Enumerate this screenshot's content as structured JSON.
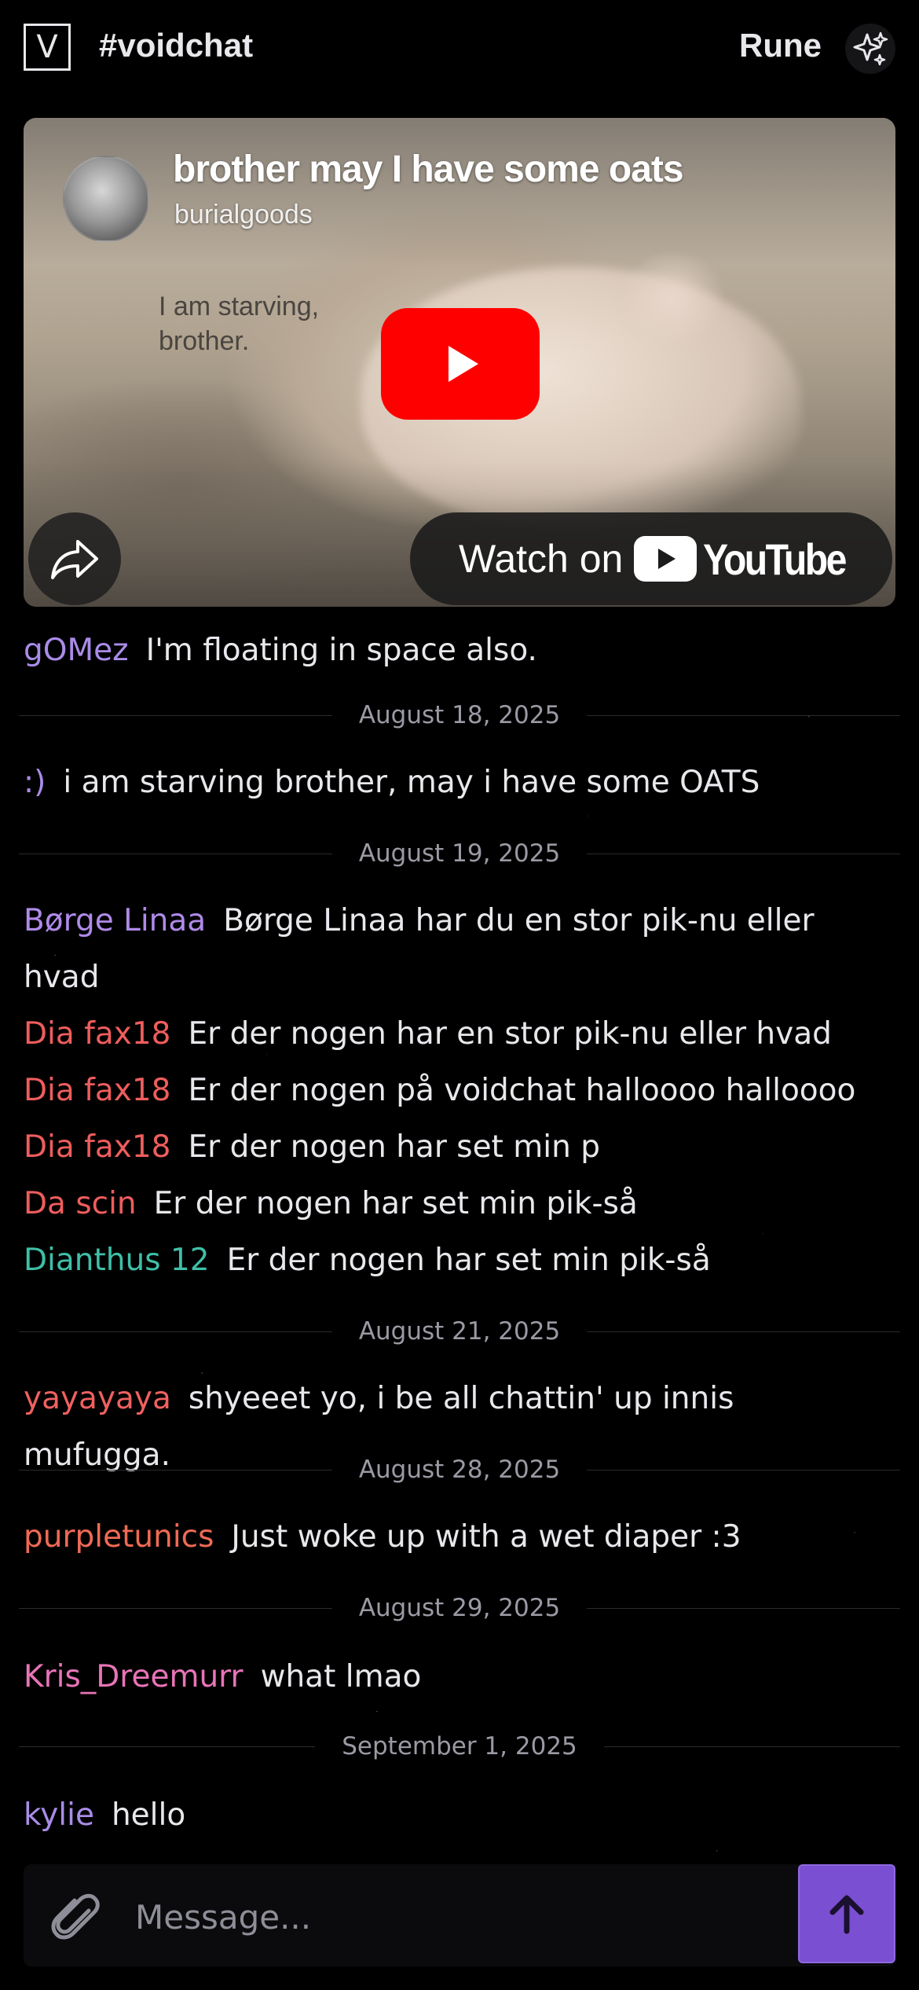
{
  "header": {
    "logo_letter": "V",
    "channel": "#voidchat",
    "username": "Rune",
    "sparkle_icon": "sparkles-icon"
  },
  "embed": {
    "title": "brother may I have some oats",
    "channel": "burialgoods",
    "caption": "I am starving, brother.",
    "watch_on": "Watch on",
    "youtube_word": "YouTube",
    "play_color": "#ff0000",
    "icons": {
      "play": "play-icon",
      "share": "share-icon",
      "youtube": "youtube-logo-icon"
    }
  },
  "messages": [
    {
      "author": "gOMez",
      "color": "#a98ce8",
      "text": "I'm floating in space also."
    },
    {
      "divider": "August 18, 2025"
    },
    {
      "author": ":)",
      "color": "#a98ce8",
      "text": "i am starving brother, may i have some OATS"
    },
    {
      "divider": "August 19, 2025"
    },
    {
      "author": "Børge Linaa",
      "color": "#b08ae8",
      "text": "Børge Linaa har du en stor pik-nu eller hvad"
    },
    {
      "author": "Dia fax18",
      "color": "#ef5d5d",
      "text": "Er der nogen har en stor pik-nu eller hvad"
    },
    {
      "author": "Dia fax18",
      "color": "#ef5d5d",
      "text": "Er der nogen på voidchat halloooo halloooo"
    },
    {
      "author": "Dia fax18",
      "color": "#ef5d5d",
      "text": "Er der nogen har set min p"
    },
    {
      "author": "Da scin",
      "color": "#ef5d5d",
      "text": "Er der nogen har set min pik-så"
    },
    {
      "author": "Dianthus 12",
      "color": "#3fbfa8",
      "text": "Er der nogen har set min pik-så"
    },
    {
      "divider": "August 21, 2025"
    },
    {
      "author": "yayayaya",
      "color": "#f06060",
      "text": "shyeeet yo, i be all chattin' up innis mufugga."
    },
    {
      "divider": "August 28, 2025"
    },
    {
      "author": "purpletunics",
      "color": "#ef6a55",
      "text": "Just woke up with a wet diaper :3"
    },
    {
      "divider": "August 29, 2025"
    },
    {
      "author": "Kris_Dreemurr",
      "color": "#e874b8",
      "text": "what lmao"
    },
    {
      "divider": "September 1, 2025"
    },
    {
      "author": "kylie",
      "color": "#a98ce8",
      "text": "hello"
    }
  ],
  "composer": {
    "placeholder": "Message...",
    "value": "",
    "attach_icon": "paperclip-icon",
    "send_icon": "arrow-up-icon",
    "send_color": "#7b4fd1"
  }
}
